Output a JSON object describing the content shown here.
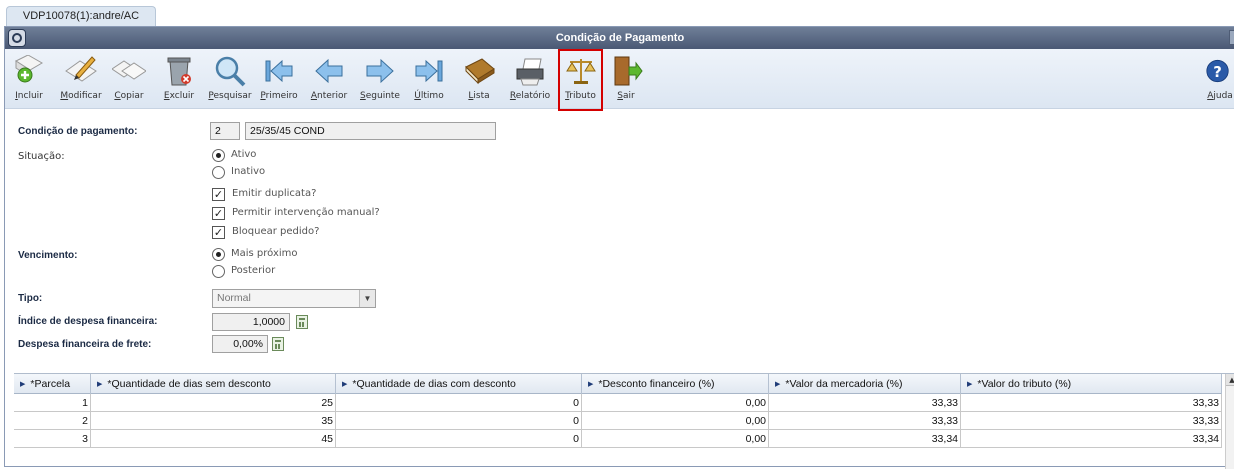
{
  "tab": {
    "label": "VDP10078(1):andre/AC"
  },
  "window": {
    "title": "Condição de Pagamento"
  },
  "toolbar": {
    "incluir": "Incluir",
    "modificar": "Modificar",
    "copiar": "Copiar",
    "excluir": "Excluir",
    "pesquisar": "Pesquisar",
    "primeiro": "Primeiro",
    "anterior": "Anterior",
    "seguinte": "Seguinte",
    "ultimo": "Último",
    "lista": "Lista",
    "relatorio": "Relatório",
    "tributo": "Tributo",
    "sair": "Sair",
    "ajuda": "Ajuda"
  },
  "form": {
    "condicao_label": "Condição de pagamento:",
    "condicao_code": "2",
    "condicao_desc": "25/35/45 COND",
    "situacao_label": "Situação:",
    "situacao_options": [
      "Ativo",
      "Inativo"
    ],
    "situacao_selected": "Ativo",
    "emitir_duplicata": "Emitir duplicata?",
    "permitir_intervencao": "Permitir intervenção manual?",
    "bloquear_pedido": "Bloquear pedido?",
    "vencimento_label": "Vencimento:",
    "vencimento_options": [
      "Mais próximo",
      "Posterior"
    ],
    "vencimento_selected": "Mais próximo",
    "tipo_label": "Tipo:",
    "tipo_value": "Normal",
    "indice_label": "Índice de despesa financeira:",
    "indice_value": "1,0000",
    "frete_label": "Despesa financeira de frete:",
    "frete_value": "0,00%"
  },
  "grid": {
    "headers": [
      "*Parcela",
      "*Quantidade de dias sem desconto",
      "*Quantidade de dias com desconto",
      "*Desconto financeiro (%)",
      "*Valor da mercadoria (%)",
      "*Valor do tributo (%)"
    ],
    "rows": [
      [
        "1",
        "25",
        "0",
        "0,00",
        "33,33",
        "33,33"
      ],
      [
        "2",
        "35",
        "0",
        "0,00",
        "33,33",
        "33,33"
      ],
      [
        "3",
        "45",
        "0",
        "0,00",
        "33,34",
        "33,34"
      ]
    ]
  },
  "colors": {
    "title_bar": "#4a5874",
    "toolbar_bg": "#dce6f2",
    "highlight": "#d40000",
    "label_text": "#1b2a44"
  }
}
